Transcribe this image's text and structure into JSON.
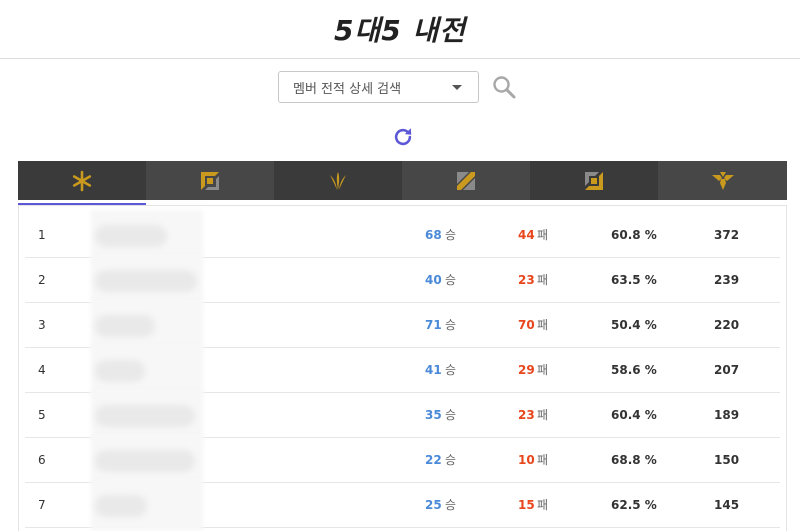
{
  "header": {
    "title": "5대5 내전"
  },
  "search": {
    "select_value": "멤버 전적 상세 검색"
  },
  "icons": {
    "search": "search-icon",
    "refresh": "refresh-icon",
    "accent": "#5b57d6",
    "gold": "#c99a1e"
  },
  "tabs": [
    {
      "icon": "all-positions-icon",
      "active": true
    },
    {
      "icon": "top-lane-icon",
      "active": false
    },
    {
      "icon": "jungle-icon",
      "active": false
    },
    {
      "icon": "mid-lane-icon",
      "active": false
    },
    {
      "icon": "bottom-lane-icon",
      "active": false
    },
    {
      "icon": "support-icon",
      "active": false
    }
  ],
  "table": {
    "rows": [
      {
        "rank": "1",
        "wins": "68",
        "win_label": "승",
        "losses": "44",
        "loss_label": "패",
        "rate": "60.8 %",
        "games": "372"
      },
      {
        "rank": "2",
        "wins": "40",
        "win_label": "승",
        "losses": "23",
        "loss_label": "패",
        "rate": "63.5 %",
        "games": "239"
      },
      {
        "rank": "3",
        "wins": "71",
        "win_label": "승",
        "losses": "70",
        "loss_label": "패",
        "rate": "50.4 %",
        "games": "220"
      },
      {
        "rank": "4",
        "wins": "41",
        "win_label": "승",
        "losses": "29",
        "loss_label": "패",
        "rate": "58.6 %",
        "games": "207"
      },
      {
        "rank": "5",
        "wins": "35",
        "win_label": "승",
        "losses": "23",
        "loss_label": "패",
        "rate": "60.4 %",
        "games": "189"
      },
      {
        "rank": "6",
        "wins": "22",
        "win_label": "승",
        "losses": "10",
        "loss_label": "패",
        "rate": "68.8 %",
        "games": "150"
      },
      {
        "rank": "7",
        "wins": "25",
        "win_label": "승",
        "losses": "15",
        "loss_label": "패",
        "rate": "62.5 %",
        "games": "145"
      }
    ]
  }
}
